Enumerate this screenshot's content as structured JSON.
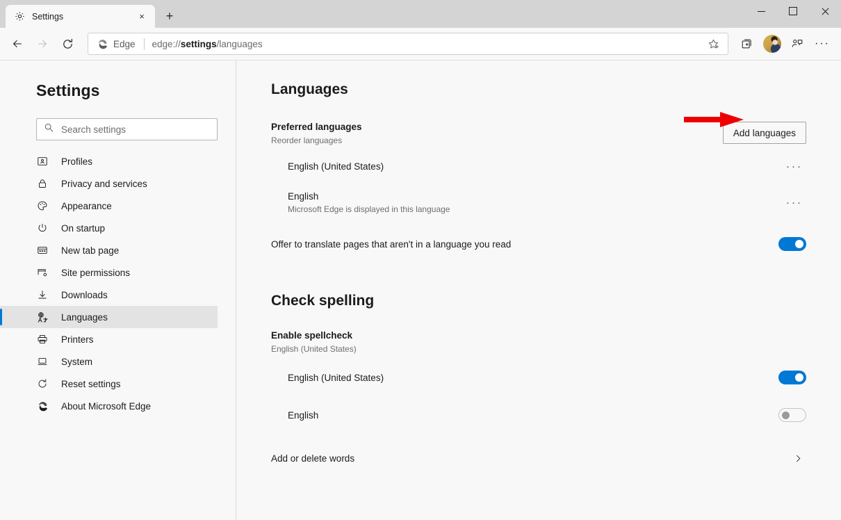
{
  "window": {
    "controls": {
      "minimize": "Minimize",
      "maximize": "Maximize",
      "close": "Close"
    }
  },
  "tabstrip": {
    "tabs": [
      {
        "title": "Settings",
        "favicon": "gear-icon",
        "close_label": "×"
      }
    ],
    "new_tab_label": "+"
  },
  "toolbar": {
    "back": "←",
    "forward": "→",
    "refresh": "↻",
    "omnibox": {
      "brand_label": "Edge",
      "url_prefix": "edge://",
      "url_bold": "settings",
      "url_suffix": "/languages",
      "full_url": "edge://settings/languages",
      "favorite_icon": "star-add-icon"
    },
    "collections_icon": "collections-icon",
    "profile_icon": "profile-avatar",
    "share_icon": "person-feedback-icon",
    "more_label": "···"
  },
  "sidebar": {
    "title": "Settings",
    "search": {
      "placeholder": "Search settings",
      "value": "",
      "icon": "search-icon"
    },
    "items": [
      {
        "label": "Profiles",
        "icon": "profile-card-icon",
        "selected": false
      },
      {
        "label": "Privacy and services",
        "icon": "lock-icon",
        "selected": false
      },
      {
        "label": "Appearance",
        "icon": "palette-icon",
        "selected": false
      },
      {
        "label": "On startup",
        "icon": "power-icon",
        "selected": false
      },
      {
        "label": "New tab page",
        "icon": "newtab-icon",
        "selected": false
      },
      {
        "label": "Site permissions",
        "icon": "site-permissions-icon",
        "selected": false
      },
      {
        "label": "Downloads",
        "icon": "download-icon",
        "selected": false
      },
      {
        "label": "Languages",
        "icon": "languages-icon",
        "selected": true
      },
      {
        "label": "Printers",
        "icon": "printer-icon",
        "selected": false
      },
      {
        "label": "System",
        "icon": "laptop-icon",
        "selected": false
      },
      {
        "label": "Reset settings",
        "icon": "reset-icon",
        "selected": false
      },
      {
        "label": "About Microsoft Edge",
        "icon": "edge-logo-icon",
        "selected": false
      }
    ]
  },
  "main": {
    "languages": {
      "heading": "Languages",
      "preferred": {
        "title": "Preferred languages",
        "subtitle": "Reorder languages",
        "add_button": "Add languages",
        "rows": [
          {
            "title": "English (United States)",
            "subtitle": "",
            "menu": "···"
          },
          {
            "title": "English",
            "subtitle": "Microsoft Edge is displayed in this language",
            "menu": "···"
          }
        ]
      },
      "translate": {
        "label": "Offer to translate pages that aren't in a language you read",
        "state": "on"
      }
    },
    "check_spelling": {
      "heading": "Check spelling",
      "enable": {
        "title": "Enable spellcheck",
        "subtitle": "English (United States)"
      },
      "rows": [
        {
          "label": "English (United States)",
          "state": "on"
        },
        {
          "label": "English",
          "state": "off"
        }
      ],
      "add_delete_words": {
        "label": "Add or delete words",
        "chevron": "›"
      }
    }
  },
  "annotation": {
    "type": "red-arrow",
    "points_to": "Add languages",
    "color": "#ee0000"
  },
  "colors": {
    "accent": "#0078d4",
    "selected_row": "#e3e3e3",
    "page_bg": "#f8f8f8",
    "titlebar": "#d4d4d4"
  }
}
